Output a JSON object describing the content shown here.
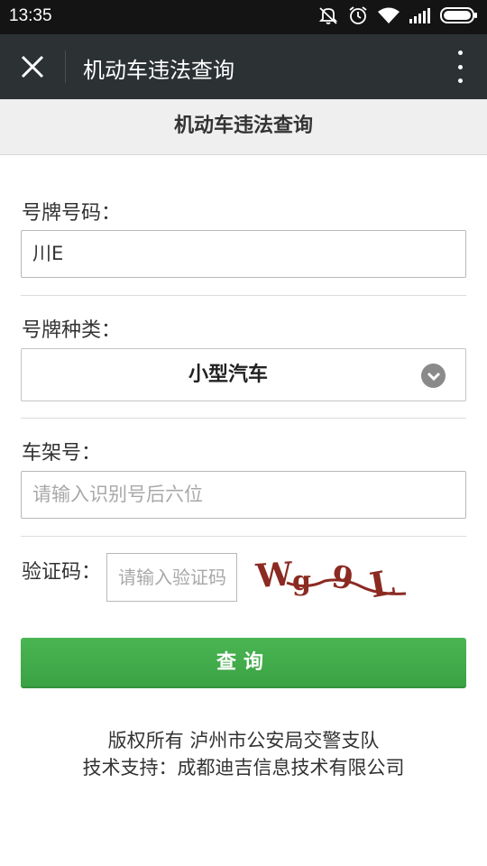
{
  "status_bar": {
    "time": "13:35",
    "icons": [
      "mute-icon",
      "alarm-icon",
      "wifi-icon",
      "signal-icon",
      "battery-icon"
    ]
  },
  "app_bar": {
    "title": "机动车违法查询",
    "close_icon": "close-icon",
    "more_icon": "more-vertical-icon"
  },
  "page": {
    "heading": "机动车违法查询"
  },
  "form": {
    "plate_number": {
      "label": "号牌号码：",
      "value": "川E"
    },
    "plate_type": {
      "label": "号牌种类：",
      "selected": "小型汽车"
    },
    "vin": {
      "label": "车架号：",
      "placeholder": "请输入识别号后六位"
    },
    "captcha": {
      "label": "验证码：",
      "placeholder": "请输入验证码",
      "image_text": "Wg9L"
    },
    "submit_label": "查询"
  },
  "footer": {
    "copyright": "版权所有 泸州市公安局交警支队",
    "support": "技术支持：成都迪吉信息技术有限公司"
  },
  "colors": {
    "status_bar": "#141414",
    "app_bar": "#2c3134",
    "accent_green": "#43ad4b",
    "captcha_text": "#8b2a22"
  }
}
